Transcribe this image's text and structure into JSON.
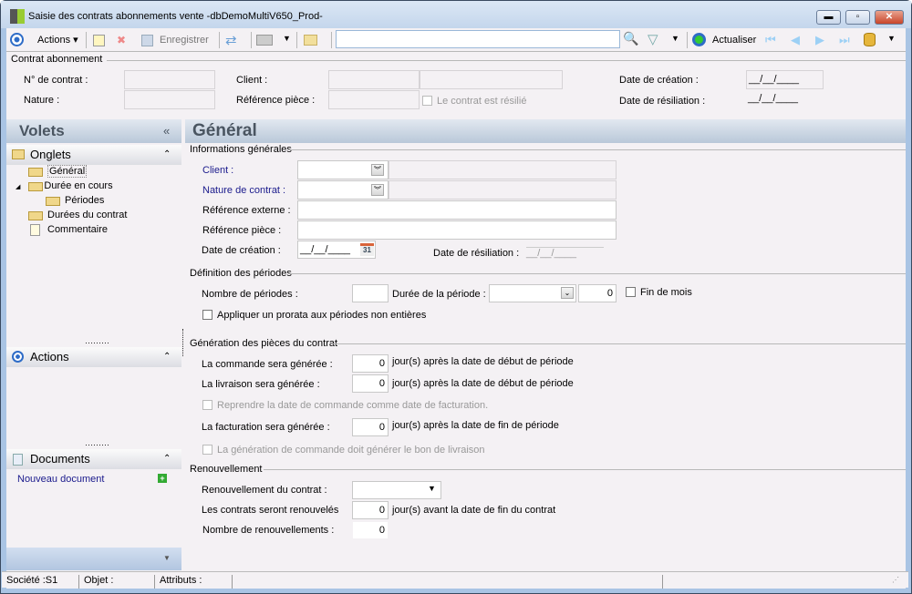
{
  "window": {
    "title": "Saisie des contrats abonnements vente -dbDemoMultiV650_Prod-",
    "minimize": "▬",
    "restore": "▫",
    "close": "✕"
  },
  "toolbar": {
    "actions": "Actions",
    "save": "Enregistrer",
    "search_value": "",
    "refresh": "Actualiser"
  },
  "header": {
    "group": "Contrat abonnement",
    "contract_no_label": "N° de contrat :",
    "nature_label": "Nature :",
    "client_label": "Client :",
    "ref_label": "Référence pièce :",
    "resilie_label": "Le contrat  est résilié",
    "date_creation_label": "Date de création :",
    "date_creation_value": "__/__/____",
    "date_resiliation_label": "Date de résiliation :",
    "date_resiliation_value": "__/__/____"
  },
  "sidebar": {
    "title": "Volets",
    "collapse": "«",
    "onglets": "Onglets",
    "tree": [
      "Général",
      "Durée en cours",
      "Périodes",
      "Durées du contrat",
      "Commentaire"
    ],
    "actions": "Actions",
    "documents": "Documents",
    "new_document": "Nouveau document"
  },
  "main": {
    "title": "Général",
    "info": {
      "group": "Informations générales",
      "client": "Client :",
      "nature": "Nature de contrat :",
      "ref_ext": "Référence externe :",
      "ref_piece": "Référence pièce :",
      "date_creation": "Date de création :",
      "date_creation_value": "__/__/____",
      "calendar": "31",
      "date_resiliation": "Date de résiliation :",
      "date_resiliation_value": "__/__/____"
    },
    "periods": {
      "group": "Définition des périodes",
      "count_label": "Nombre de périodes :",
      "duration_label": "Durée de la période :",
      "duration_value": "0",
      "end_of_month": "Fin de mois",
      "prorata": "Appliquer un prorata aux périodes non entières"
    },
    "generation": {
      "group": "Génération des pièces du contrat",
      "order_label": "La commande sera générée :",
      "order_value": "0",
      "order_suffix": "jour(s) après la date de début de période",
      "delivery_label": "La livraison sera générée :",
      "delivery_value": "0",
      "delivery_suffix": "jour(s) après la date de début de période",
      "reuse_date": "Reprendre la date de commande comme date de facturation.",
      "invoice_label": "La facturation sera générée :",
      "invoice_value": "0",
      "invoice_suffix": "jour(s) après la date de fin de période",
      "gen_delivery": "La génération de commande doit générer le bon de livraison"
    },
    "renewal": {
      "group": "Renouvellement",
      "renewal_label": "Renouvellement du contrat :",
      "renewed_label": "Les contrats seront renouvelés",
      "renewed_value": "0",
      "renewed_suffix": "jour(s) avant la date de fin du contrat",
      "count_label": "Nombre de renouvellements :",
      "count_value": "0"
    }
  },
  "status": {
    "company": "Société :S1",
    "object": "Objet :",
    "attributes": "Attributs :"
  }
}
